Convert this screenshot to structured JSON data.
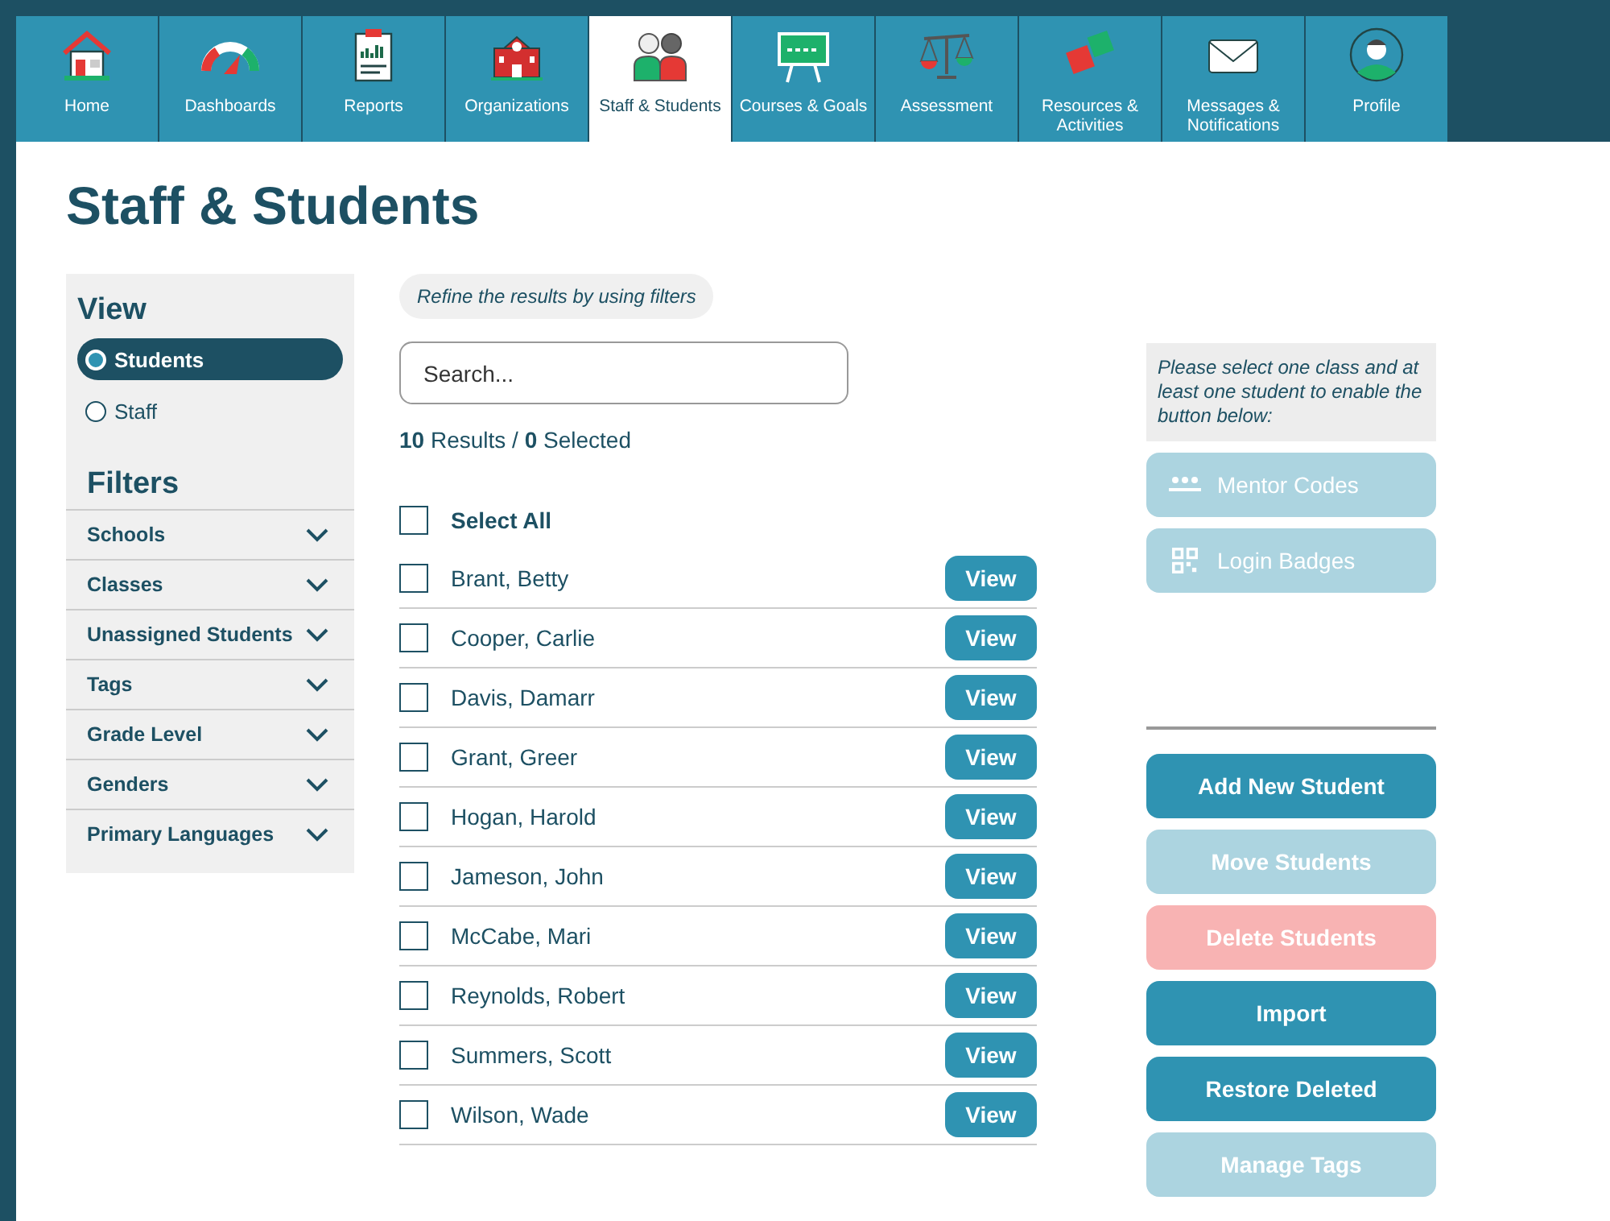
{
  "nav_tabs": [
    {
      "label": "Home",
      "selected": false
    },
    {
      "label": "Dashboards",
      "selected": false
    },
    {
      "label": "Reports",
      "selected": false
    },
    {
      "label": "Organizations",
      "selected": false
    },
    {
      "label": "Staff & Students",
      "selected": true
    },
    {
      "label": "Courses & Goals",
      "selected": false
    },
    {
      "label": "Assessment",
      "selected": false
    },
    {
      "label": "Resources & Activities",
      "selected": false
    },
    {
      "label": "Messages & Notifications",
      "selected": false
    },
    {
      "label": "Profile",
      "selected": false
    }
  ],
  "page_title": "Staff & Students",
  "sidebar": {
    "view_heading": "View",
    "view_options": [
      {
        "label": "Students",
        "selected": true
      },
      {
        "label": "Staff",
        "selected": false
      }
    ],
    "filters_heading": "Filters",
    "filters": [
      {
        "label": "Schools",
        "expanded": false
      },
      {
        "label": "Classes",
        "expanded": false
      },
      {
        "label": "Unassigned Students",
        "expanded": false
      },
      {
        "label": "Tags",
        "expanded": false
      },
      {
        "label": "Grade Level",
        "expanded": false
      },
      {
        "label": "Genders",
        "expanded": false
      },
      {
        "label": "Primary Languages",
        "expanded": false
      }
    ]
  },
  "hint": "Refine the results by using filters",
  "search": {
    "placeholder": "Search..."
  },
  "result_summary": "**10** Results / **0** Selected",
  "select_all": {
    "label": "Select All",
    "checked": false
  },
  "students": [
    {
      "name": "Brant, Betty",
      "checked": false,
      "action": "View"
    },
    {
      "name": "Cooper, Carlie",
      "checked": false,
      "action": "View"
    },
    {
      "name": "Davis, Damarr",
      "checked": false,
      "action": "View"
    },
    {
      "name": "Grant, Greer",
      "checked": false,
      "action": "View"
    },
    {
      "name": "Hogan, Harold",
      "checked": false,
      "action": "View"
    },
    {
      "name": "Jameson, John",
      "checked": false,
      "action": "View"
    },
    {
      "name": "McCabe, Mari",
      "checked": false,
      "action": "View"
    },
    {
      "name": "Reynolds, Robert",
      "checked": false,
      "action": "View"
    },
    {
      "name": "Summers, Scott",
      "checked": false,
      "action": "View"
    },
    {
      "name": "Wilson, Wade",
      "checked": false,
      "action": "View"
    }
  ],
  "class_actions": {
    "note": "Please select one class and at least one student to enable the button below:",
    "buttons": [
      {
        "label": "Mentor Codes",
        "kind": "codes",
        "disabled": true
      },
      {
        "label": "Login Badges",
        "kind": "badges",
        "disabled": true
      }
    ]
  },
  "student_actions": [
    {
      "label": "Add New Student",
      "kind": "normal",
      "disabled": false
    },
    {
      "label": "Move Students",
      "kind": "normal",
      "disabled": true
    },
    {
      "label": "Delete Students",
      "kind": "danger",
      "disabled": true
    },
    {
      "label": "Import",
      "kind": "normal",
      "disabled": false
    },
    {
      "label": "Restore Deleted",
      "kind": "normal",
      "disabled": false
    },
    {
      "label": "Manage Tags",
      "kind": "normal",
      "disabled": true
    }
  ]
}
